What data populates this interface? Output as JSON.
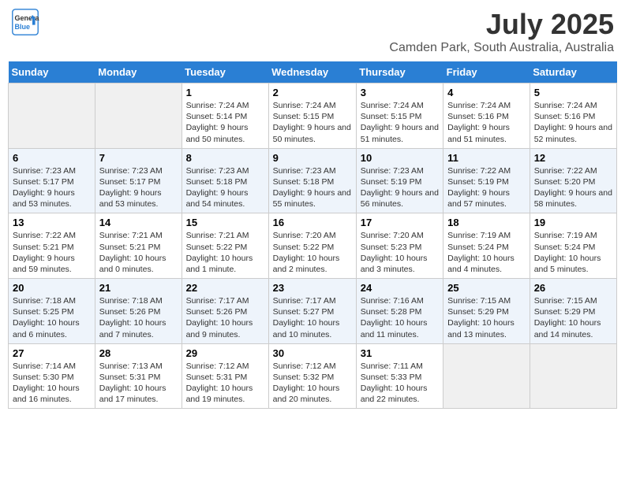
{
  "header": {
    "logo_line1": "General",
    "logo_line2": "Blue",
    "month_year": "July 2025",
    "location": "Camden Park, South Australia, Australia"
  },
  "weekdays": [
    "Sunday",
    "Monday",
    "Tuesday",
    "Wednesday",
    "Thursday",
    "Friday",
    "Saturday"
  ],
  "weeks": [
    [
      {
        "day": "",
        "info": ""
      },
      {
        "day": "",
        "info": ""
      },
      {
        "day": "1",
        "info": "Sunrise: 7:24 AM\nSunset: 5:14 PM\nDaylight: 9 hours and 50 minutes."
      },
      {
        "day": "2",
        "info": "Sunrise: 7:24 AM\nSunset: 5:15 PM\nDaylight: 9 hours and 50 minutes."
      },
      {
        "day": "3",
        "info": "Sunrise: 7:24 AM\nSunset: 5:15 PM\nDaylight: 9 hours and 51 minutes."
      },
      {
        "day": "4",
        "info": "Sunrise: 7:24 AM\nSunset: 5:16 PM\nDaylight: 9 hours and 51 minutes."
      },
      {
        "day": "5",
        "info": "Sunrise: 7:24 AM\nSunset: 5:16 PM\nDaylight: 9 hours and 52 minutes."
      }
    ],
    [
      {
        "day": "6",
        "info": "Sunrise: 7:23 AM\nSunset: 5:17 PM\nDaylight: 9 hours and 53 minutes."
      },
      {
        "day": "7",
        "info": "Sunrise: 7:23 AM\nSunset: 5:17 PM\nDaylight: 9 hours and 53 minutes."
      },
      {
        "day": "8",
        "info": "Sunrise: 7:23 AM\nSunset: 5:18 PM\nDaylight: 9 hours and 54 minutes."
      },
      {
        "day": "9",
        "info": "Sunrise: 7:23 AM\nSunset: 5:18 PM\nDaylight: 9 hours and 55 minutes."
      },
      {
        "day": "10",
        "info": "Sunrise: 7:23 AM\nSunset: 5:19 PM\nDaylight: 9 hours and 56 minutes."
      },
      {
        "day": "11",
        "info": "Sunrise: 7:22 AM\nSunset: 5:19 PM\nDaylight: 9 hours and 57 minutes."
      },
      {
        "day": "12",
        "info": "Sunrise: 7:22 AM\nSunset: 5:20 PM\nDaylight: 9 hours and 58 minutes."
      }
    ],
    [
      {
        "day": "13",
        "info": "Sunrise: 7:22 AM\nSunset: 5:21 PM\nDaylight: 9 hours and 59 minutes."
      },
      {
        "day": "14",
        "info": "Sunrise: 7:21 AM\nSunset: 5:21 PM\nDaylight: 10 hours and 0 minutes."
      },
      {
        "day": "15",
        "info": "Sunrise: 7:21 AM\nSunset: 5:22 PM\nDaylight: 10 hours and 1 minute."
      },
      {
        "day": "16",
        "info": "Sunrise: 7:20 AM\nSunset: 5:22 PM\nDaylight: 10 hours and 2 minutes."
      },
      {
        "day": "17",
        "info": "Sunrise: 7:20 AM\nSunset: 5:23 PM\nDaylight: 10 hours and 3 minutes."
      },
      {
        "day": "18",
        "info": "Sunrise: 7:19 AM\nSunset: 5:24 PM\nDaylight: 10 hours and 4 minutes."
      },
      {
        "day": "19",
        "info": "Sunrise: 7:19 AM\nSunset: 5:24 PM\nDaylight: 10 hours and 5 minutes."
      }
    ],
    [
      {
        "day": "20",
        "info": "Sunrise: 7:18 AM\nSunset: 5:25 PM\nDaylight: 10 hours and 6 minutes."
      },
      {
        "day": "21",
        "info": "Sunrise: 7:18 AM\nSunset: 5:26 PM\nDaylight: 10 hours and 7 minutes."
      },
      {
        "day": "22",
        "info": "Sunrise: 7:17 AM\nSunset: 5:26 PM\nDaylight: 10 hours and 9 minutes."
      },
      {
        "day": "23",
        "info": "Sunrise: 7:17 AM\nSunset: 5:27 PM\nDaylight: 10 hours and 10 minutes."
      },
      {
        "day": "24",
        "info": "Sunrise: 7:16 AM\nSunset: 5:28 PM\nDaylight: 10 hours and 11 minutes."
      },
      {
        "day": "25",
        "info": "Sunrise: 7:15 AM\nSunset: 5:29 PM\nDaylight: 10 hours and 13 minutes."
      },
      {
        "day": "26",
        "info": "Sunrise: 7:15 AM\nSunset: 5:29 PM\nDaylight: 10 hours and 14 minutes."
      }
    ],
    [
      {
        "day": "27",
        "info": "Sunrise: 7:14 AM\nSunset: 5:30 PM\nDaylight: 10 hours and 16 minutes."
      },
      {
        "day": "28",
        "info": "Sunrise: 7:13 AM\nSunset: 5:31 PM\nDaylight: 10 hours and 17 minutes."
      },
      {
        "day": "29",
        "info": "Sunrise: 7:12 AM\nSunset: 5:31 PM\nDaylight: 10 hours and 19 minutes."
      },
      {
        "day": "30",
        "info": "Sunrise: 7:12 AM\nSunset: 5:32 PM\nDaylight: 10 hours and 20 minutes."
      },
      {
        "day": "31",
        "info": "Sunrise: 7:11 AM\nSunset: 5:33 PM\nDaylight: 10 hours and 22 minutes."
      },
      {
        "day": "",
        "info": ""
      },
      {
        "day": "",
        "info": ""
      }
    ]
  ]
}
